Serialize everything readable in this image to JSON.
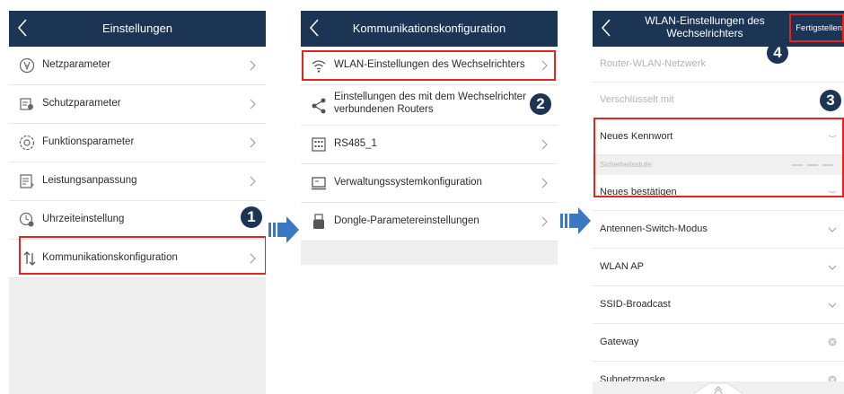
{
  "screen1": {
    "title": "Einstellungen",
    "items": [
      {
        "label": "Netzparameter",
        "icon": "grid-parameter-icon"
      },
      {
        "label": "Schutzparameter",
        "icon": "protection-icon"
      },
      {
        "label": "Funktionsparameter",
        "icon": "function-gear-icon"
      },
      {
        "label": "Leistungsanpassung",
        "icon": "power-adjust-icon"
      },
      {
        "label": "Uhrzeiteinstellung",
        "icon": "clock-gear-icon"
      },
      {
        "label": "Kommunikationskonfiguration",
        "icon": "communication-arrows-icon"
      }
    ]
  },
  "screen2": {
    "title": "Kommunikationskonfiguration",
    "items": [
      {
        "label": "WLAN-Einstellungen des Wechselrichters",
        "icon": "wifi-icon"
      },
      {
        "label_line1": "Einstellungen des mit dem Wechselrichter",
        "label_line2": "verbundenen Routers",
        "icon": "share-icon"
      },
      {
        "label": "RS485_1",
        "icon": "rs485-port-icon"
      },
      {
        "label": "Verwaltungssystemkonfiguration",
        "icon": "monitor-icon"
      },
      {
        "label": "Dongle-Parametereinstellungen",
        "icon": "dongle-icon"
      }
    ]
  },
  "screen3": {
    "title_line1": "WLAN-Einstellungen des",
    "title_line2": "Wechselrichters",
    "done_label": "Fertigstellen",
    "rows": {
      "router_network": "Router-WLAN-Netzwerk",
      "encrypted_with": "Verschlüsselt mit",
      "new_password": "Neues Kennwort",
      "security_level": "Sicherheitsstufe:",
      "confirm_new": "Neues bestätigen",
      "antenna_switch": "Antennen-Switch-Modus",
      "wlan_ap": "WLAN AP",
      "ssid_broadcast": "SSID-Broadcast",
      "gateway": "Gateway",
      "subnet_mask": "Subnetzmaske"
    }
  },
  "steps": [
    "1",
    "2",
    "3",
    "4"
  ],
  "colors": {
    "header": "#1d3554",
    "highlight": "#e52420",
    "arrow": "#3a78c2",
    "badge": "#1d3554"
  }
}
